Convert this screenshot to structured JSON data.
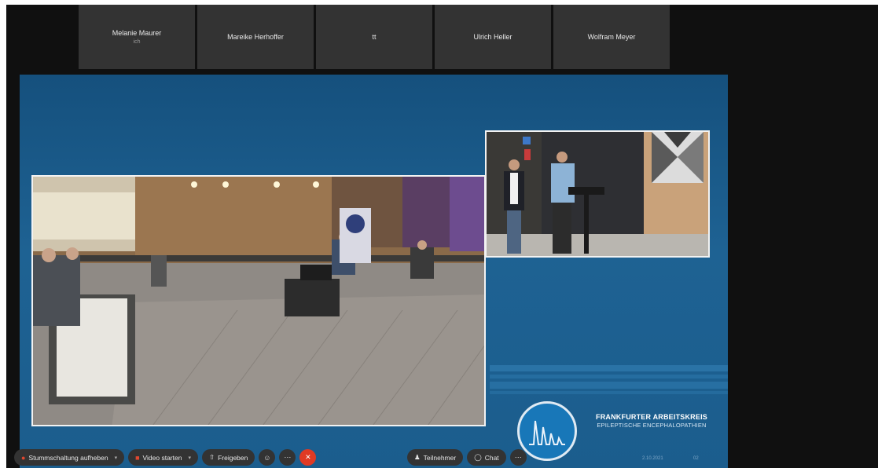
{
  "participants": [
    {
      "name": "Melanie Maurer",
      "sub": "ich"
    },
    {
      "name": "Mareike Herhoffer",
      "sub": ""
    },
    {
      "name": "tt",
      "sub": ""
    },
    {
      "name": "Ulrich Heller",
      "sub": ""
    },
    {
      "name": "Wolfram Meyer",
      "sub": ""
    }
  ],
  "slide": {
    "org_line1": "FRANKFURTER ARBEITSKREIS",
    "org_line2": "EPILEPTISCHE ENCEPHALOPATHIEN",
    "footer_date": "2.10.2021",
    "footer_page": "02"
  },
  "toolbar": {
    "mute_label": "Stummschaltung aufheben",
    "video_label": "Video starten",
    "share_label": "Freigeben",
    "participants_label": "Teilnehmer",
    "chat_label": "Chat"
  },
  "colors": {
    "leave": "#e03a24",
    "slide_bg": "#1a5a88"
  }
}
